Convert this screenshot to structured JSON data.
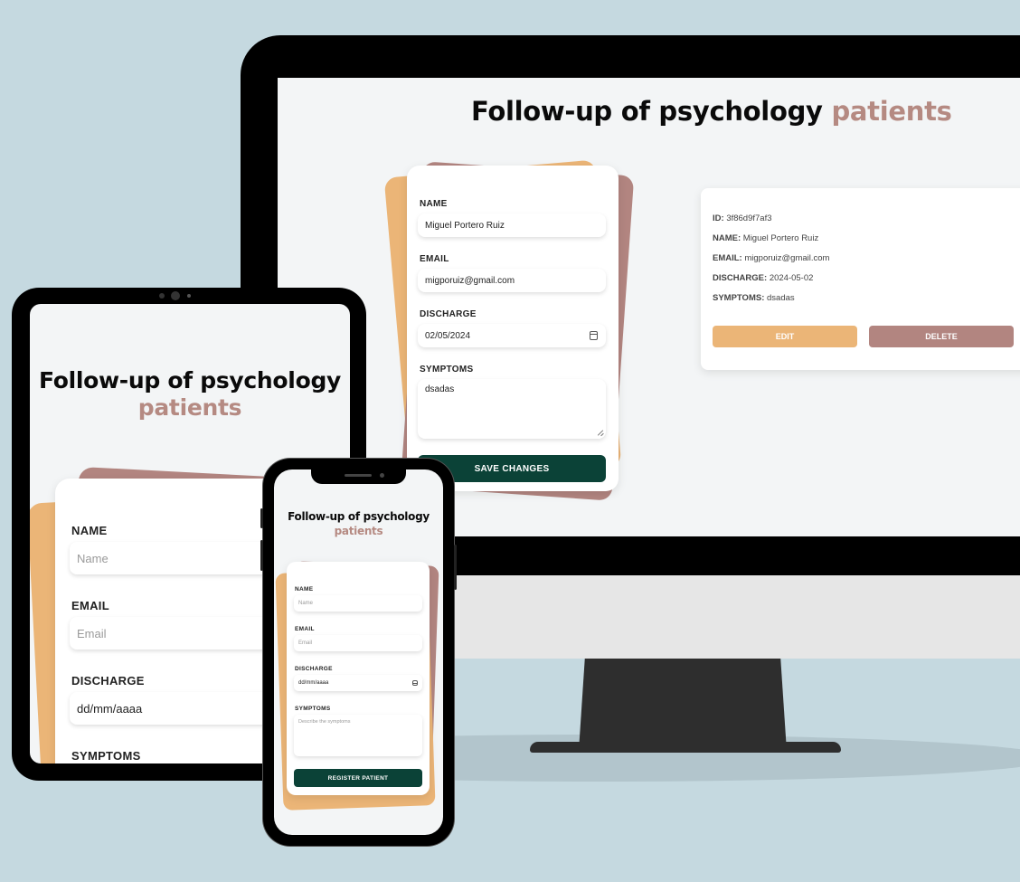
{
  "title": {
    "main": "Follow-up of psychology",
    "accent": "patients"
  },
  "desktop": {
    "form": {
      "name_label": "NAME",
      "name_value": "Miguel Portero Ruiz",
      "email_label": "EMAIL",
      "email_value": "migporuiz@gmail.com",
      "discharge_label": "DISCHARGE",
      "discharge_value": "02/05/2024",
      "symptoms_label": "SYMPTOMS",
      "symptoms_value": "dsadas",
      "submit_label": "SAVE CHANGES"
    },
    "patient_card": {
      "id_label": "ID:",
      "id_value": "3f86d9f7af3",
      "name_label": "NAME:",
      "name_value": "Miguel Portero Ruiz",
      "email_label": "EMAIL:",
      "email_value": "migporuiz@gmail.com",
      "discharge_label": "DISCHARGE:",
      "discharge_value": "2024-05-02",
      "symptoms_label": "SYMPTOMS:",
      "symptoms_value": "dsadas",
      "edit_label": "EDIT",
      "delete_label": "DELETE"
    }
  },
  "tablet": {
    "form": {
      "name_label": "NAME",
      "name_placeholder": "Name",
      "email_label": "EMAIL",
      "email_placeholder": "Email",
      "discharge_label": "DISCHARGE",
      "discharge_placeholder": "dd/mm/aaaa",
      "symptoms_label": "SYMPTOMS"
    }
  },
  "phone": {
    "form": {
      "name_label": "NAME",
      "name_placeholder": "Name",
      "email_label": "EMAIL",
      "email_placeholder": "Email",
      "discharge_label": "DISCHARGE",
      "discharge_placeholder": "dd/mm/aaaa",
      "symptoms_label": "SYMPTOMS",
      "symptoms_placeholder": "Describe the symptoms",
      "submit_label": "REGISTER PATIENT"
    }
  },
  "colors": {
    "background": "#c5d9e0",
    "accent_text": "#b58a82",
    "orange": "#ebb577",
    "mauve": "#b28580",
    "primary_button": "#0b4237"
  }
}
